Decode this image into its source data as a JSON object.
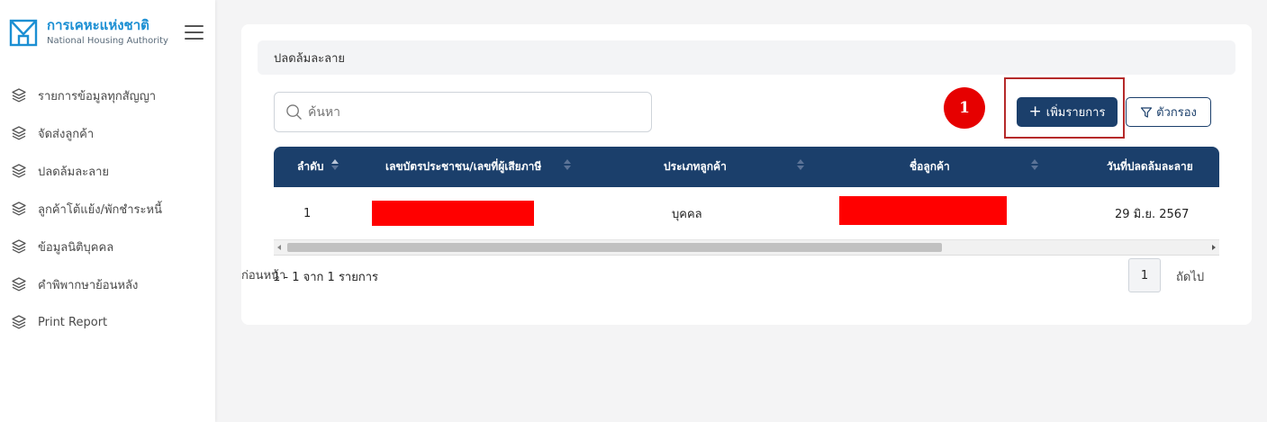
{
  "brand": {
    "name_th": "การเคหะแห่งชาติ",
    "name_en": "National Housing Authority",
    "logo_color": "#1b8fd3"
  },
  "sidebar": {
    "items": [
      {
        "label": "รายการข้อมูลทุกสัญญา",
        "icon": "layers-icon"
      },
      {
        "label": "จัดส่งลูกค้า",
        "icon": "layers-icon"
      },
      {
        "label": "ปลดล้มละลาย",
        "icon": "layers-icon"
      },
      {
        "label": "ลูกค้าโต้แย้ง/พักชำระหนี้",
        "icon": "layers-icon"
      },
      {
        "label": "ข้อมูลนิติบุคคล",
        "icon": "layers-icon"
      },
      {
        "label": "คำพิพากษาย้อนหลัง",
        "icon": "layers-icon"
      },
      {
        "label": "Print Report",
        "icon": "layers-icon"
      }
    ]
  },
  "page": {
    "title": "ปลดล้มละลาย"
  },
  "search": {
    "placeholder": "ค้นหา"
  },
  "annotation": {
    "badge_number": "1",
    "badge_color": "#e60000"
  },
  "toolbar": {
    "add_label": "เพิ่มรายการ",
    "filter_label": "ตัวกรอง"
  },
  "table": {
    "headers": [
      "ลำดับ",
      "เลขบัตรประชาชน/เลขที่ผู้เสียภาษี",
      "ประเภทลูกค้า",
      "ชื่อลูกค้า",
      "วันที่ปลดล้มละลาย"
    ],
    "rows": [
      {
        "index": "1",
        "tax_id": "",
        "customer_type": "บุคคล",
        "customer_name": "",
        "discharge_date": "29 มิ.ย. 2567"
      }
    ],
    "header_color": "#1b3f6b"
  },
  "pagination": {
    "summary": "1 - 1 จาก 1 รายการ",
    "prev_label": "ก่อนหน้า",
    "current_page": "1",
    "next_label": "ถัดไป"
  }
}
